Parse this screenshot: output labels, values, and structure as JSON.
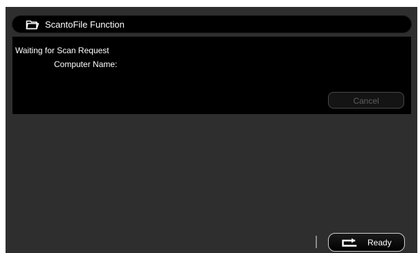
{
  "header": {
    "title": "ScantoFile Function",
    "icon": "folder-icon"
  },
  "panel": {
    "status": "Waiting for Scan Request",
    "computer_name_label": "Computer Name:",
    "cancel_label": "Cancel"
  },
  "footer": {
    "ready_label": "Ready",
    "ready_icon": "return-arrow-icon"
  },
  "colors": {
    "screen_background": "#2e2e2e",
    "panel_background": "#000000",
    "text": "#ffffff",
    "disabled_text": "#5e5e5e"
  }
}
